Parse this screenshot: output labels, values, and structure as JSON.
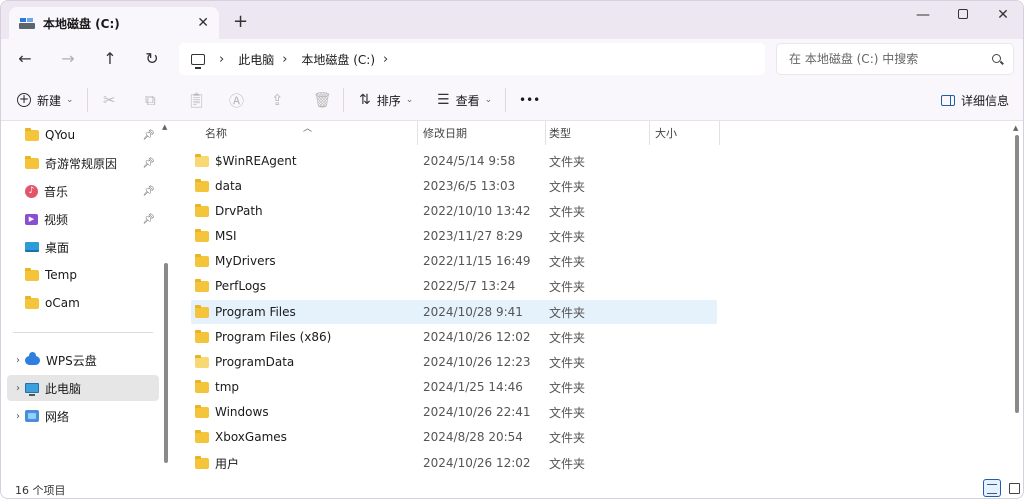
{
  "window": {
    "tab_title": "本地磁盘 (C:)",
    "tab_close": "✕",
    "new_tab": "+",
    "minimize": "—",
    "close": "✕"
  },
  "nav": {
    "back": "←",
    "forward": "→",
    "up": "↑",
    "refresh": "↻"
  },
  "address": {
    "sep": "›",
    "crumbs": [
      "此电脑",
      "本地磁盘 (C:)"
    ]
  },
  "search": {
    "placeholder": "在 本地磁盘 (C:) 中搜索"
  },
  "toolbar": {
    "new_label": "新建",
    "sort_label": "排序",
    "view_label": "查看",
    "more": "•••",
    "details_label": "详细信息"
  },
  "sidebar": {
    "items": [
      {
        "label": "QYou",
        "icon": "folder-icon",
        "pinned": true
      },
      {
        "label": "奇游常规原因",
        "icon": "folder-icon",
        "pinned": true
      },
      {
        "label": "音乐",
        "icon": "music-icon",
        "pinned": true
      },
      {
        "label": "视频",
        "icon": "video-icon",
        "pinned": true
      },
      {
        "label": "桌面",
        "icon": "desktop-icon",
        "pinned": false
      },
      {
        "label": "Temp",
        "icon": "folder-icon",
        "pinned": false
      },
      {
        "label": "oCam",
        "icon": "folder-icon",
        "pinned": false
      },
      {
        "label": "WPS云盘",
        "icon": "cloud-icon",
        "pinned": false
      },
      {
        "label": "此电脑",
        "icon": "monitor-icon",
        "pinned": false
      },
      {
        "label": "网络",
        "icon": "network-icon",
        "pinned": false
      }
    ]
  },
  "columns": {
    "name": "名称",
    "modified": "修改日期",
    "type": "类型",
    "size": "大小"
  },
  "files": [
    {
      "name": "$WinREAgent",
      "modified": "2024/5/14 9:58",
      "type": "文件夹"
    },
    {
      "name": "data",
      "modified": "2023/6/5 13:03",
      "type": "文件夹"
    },
    {
      "name": "DrvPath",
      "modified": "2022/10/10 13:42",
      "type": "文件夹"
    },
    {
      "name": "MSI",
      "modified": "2023/11/27 8:29",
      "type": "文件夹"
    },
    {
      "name": "MyDrivers",
      "modified": "2022/11/15 16:49",
      "type": "文件夹"
    },
    {
      "name": "PerfLogs",
      "modified": "2022/5/7 13:24",
      "type": "文件夹"
    },
    {
      "name": "Program Files",
      "modified": "2024/10/28 9:41",
      "type": "文件夹"
    },
    {
      "name": "Program Files (x86)",
      "modified": "2024/10/26 12:02",
      "type": "文件夹"
    },
    {
      "name": "ProgramData",
      "modified": "2024/10/26 12:23",
      "type": "文件夹"
    },
    {
      "name": "tmp",
      "modified": "2024/1/25 14:46",
      "type": "文件夹"
    },
    {
      "name": "Windows",
      "modified": "2024/10/26 22:41",
      "type": "文件夹"
    },
    {
      "name": "XboxGames",
      "modified": "2024/8/28 20:54",
      "type": "文件夹"
    },
    {
      "name": "用户",
      "modified": "2024/10/26 12:02",
      "type": "文件夹"
    }
  ],
  "status": {
    "count": "16 个项目"
  },
  "colors": {
    "titlebar_bg": "#ece7f1",
    "toolbar_bg": "#f9f7fb",
    "selected_row": "#e5f1fb",
    "folder": "#f4c53b",
    "accent": "#1f5fa6"
  }
}
